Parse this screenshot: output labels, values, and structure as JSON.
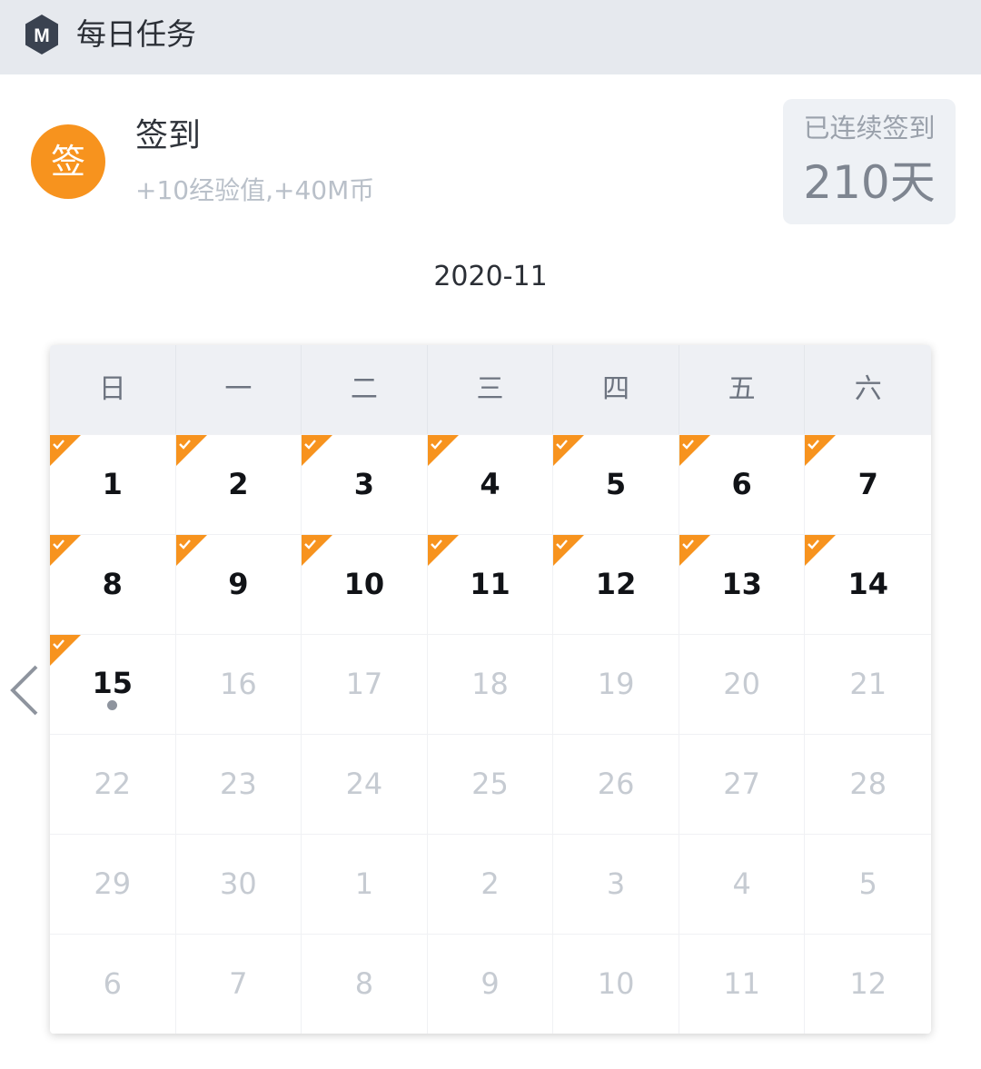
{
  "header": {
    "title": "每日任务",
    "logo_letter": "M"
  },
  "sign": {
    "badge": "签",
    "title": "签到",
    "reward": "+10经验值,+40M币",
    "streak_label": "已连续签到",
    "streak_value": "210天"
  },
  "calendar": {
    "month": "2020-11",
    "weekdays": [
      "日",
      "一",
      "二",
      "三",
      "四",
      "五",
      "六"
    ],
    "days": [
      {
        "label": "1",
        "current": true,
        "signed": true
      },
      {
        "label": "2",
        "current": true,
        "signed": true
      },
      {
        "label": "3",
        "current": true,
        "signed": true
      },
      {
        "label": "4",
        "current": true,
        "signed": true
      },
      {
        "label": "5",
        "current": true,
        "signed": true
      },
      {
        "label": "6",
        "current": true,
        "signed": true
      },
      {
        "label": "7",
        "current": true,
        "signed": true
      },
      {
        "label": "8",
        "current": true,
        "signed": true
      },
      {
        "label": "9",
        "current": true,
        "signed": true
      },
      {
        "label": "10",
        "current": true,
        "signed": true
      },
      {
        "label": "11",
        "current": true,
        "signed": true
      },
      {
        "label": "12",
        "current": true,
        "signed": true
      },
      {
        "label": "13",
        "current": true,
        "signed": true
      },
      {
        "label": "14",
        "current": true,
        "signed": true
      },
      {
        "label": "15",
        "current": true,
        "signed": true,
        "today": true
      },
      {
        "label": "16"
      },
      {
        "label": "17"
      },
      {
        "label": "18"
      },
      {
        "label": "19"
      },
      {
        "label": "20"
      },
      {
        "label": "21"
      },
      {
        "label": "22"
      },
      {
        "label": "23"
      },
      {
        "label": "24"
      },
      {
        "label": "25"
      },
      {
        "label": "26"
      },
      {
        "label": "27"
      },
      {
        "label": "28"
      },
      {
        "label": "29"
      },
      {
        "label": "30"
      },
      {
        "label": "1"
      },
      {
        "label": "2"
      },
      {
        "label": "3"
      },
      {
        "label": "4"
      },
      {
        "label": "5"
      },
      {
        "label": "6"
      },
      {
        "label": "7"
      },
      {
        "label": "8"
      },
      {
        "label": "9"
      },
      {
        "label": "10"
      },
      {
        "label": "11"
      },
      {
        "label": "12"
      }
    ]
  },
  "colors": {
    "accent": "#f7931e",
    "topbar_bg": "#e6e9ee",
    "today_dot": "#8e949e"
  },
  "icons": {
    "logo": "hexagon-m-logo-icon",
    "signed_marker": "check-corner-icon",
    "prev": "chevron-left-icon"
  }
}
